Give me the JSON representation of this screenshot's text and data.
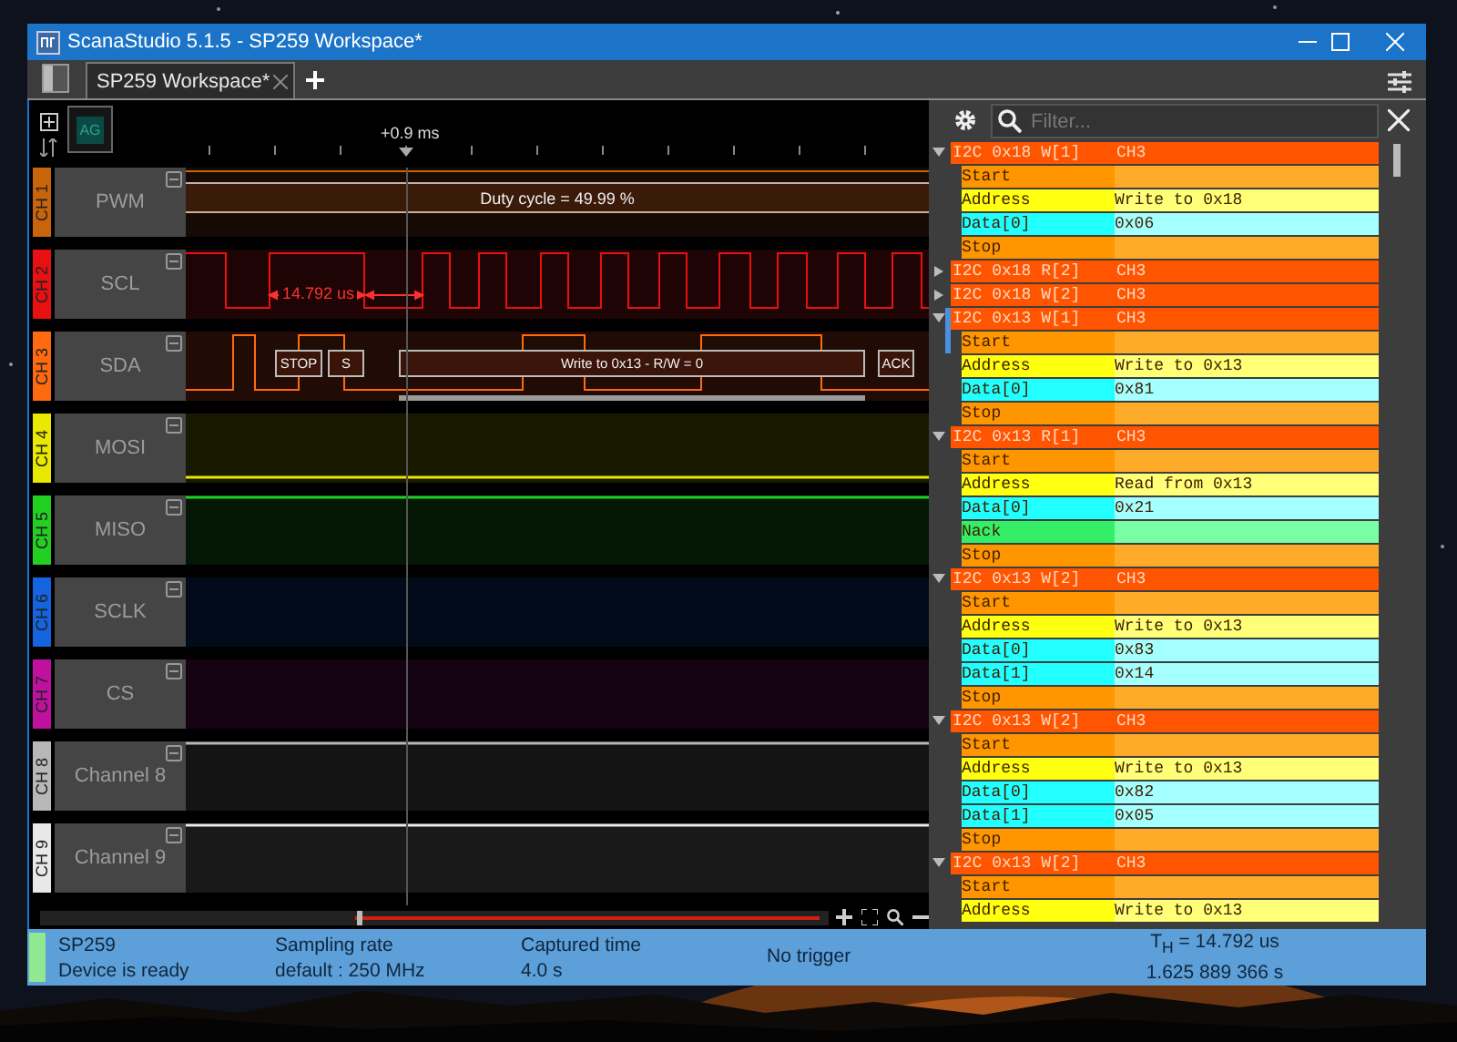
{
  "window": {
    "title": "ScanaStudio 5.1.5 - SP259 Workspace*"
  },
  "tabs": [
    {
      "label": "SP259 Workspace*",
      "selected": true
    }
  ],
  "ruler": {
    "group_button": "AG",
    "cursor_label": "+0.9 ms"
  },
  "channels": [
    {
      "tag": "CH 1",
      "name": "PWM",
      "color": "#c8650a",
      "kind": "pwm",
      "annotation": "Duty cycle = 49.99 %"
    },
    {
      "tag": "CH 2",
      "name": "SCL",
      "color": "#e81010",
      "kind": "clock",
      "measurement": "14.792 us"
    },
    {
      "tag": "CH 3",
      "name": "SDA",
      "color": "#ff6a10",
      "kind": "data",
      "frames": [
        "STOP",
        "S",
        "Write to 0x13 - R/W = 0",
        "ACK"
      ]
    },
    {
      "tag": "CH 4",
      "name": "MOSI",
      "color": "#e8e800",
      "kind": "low"
    },
    {
      "tag": "CH 5",
      "name": "MISO",
      "color": "#22d022",
      "kind": "high"
    },
    {
      "tag": "CH 6",
      "name": "SCLK",
      "color": "#1464e0",
      "kind": "idle"
    },
    {
      "tag": "CH 7",
      "name": "CS",
      "color": "#c010a0",
      "kind": "idle"
    },
    {
      "tag": "CH 8",
      "name": "Channel 8",
      "color": "#b8b8b8",
      "kind": "high"
    },
    {
      "tag": "CH 9",
      "name": "Channel 9",
      "color": "#e8e8e8",
      "kind": "high"
    }
  ],
  "decoder": {
    "filter_placeholder": "Filter...",
    "packets": [
      {
        "title": "I2C 0x18 W[1]",
        "channel": "CH3",
        "expanded": true,
        "selected": false,
        "fields": [
          {
            "kind": "start",
            "label": "Start"
          },
          {
            "kind": "address",
            "label": "Address",
            "value": "Write to 0x18"
          },
          {
            "kind": "data",
            "label": "Data[0]",
            "value": "0x06"
          },
          {
            "kind": "stop",
            "label": "Stop"
          }
        ]
      },
      {
        "title": "I2C 0x18 R[2]",
        "channel": "CH3",
        "expanded": false,
        "selected": false
      },
      {
        "title": "I2C 0x18 W[2]",
        "channel": "CH3",
        "expanded": false,
        "selected": false
      },
      {
        "title": "I2C 0x13 W[1]",
        "channel": "CH3",
        "expanded": true,
        "selected": true,
        "fields": [
          {
            "kind": "start",
            "label": "Start"
          },
          {
            "kind": "address",
            "label": "Address",
            "value": "Write to 0x13"
          },
          {
            "kind": "data",
            "label": "Data[0]",
            "value": "0x81"
          },
          {
            "kind": "stop",
            "label": "Stop"
          }
        ]
      },
      {
        "title": "I2C 0x13 R[1]",
        "channel": "CH3",
        "expanded": true,
        "selected": false,
        "fields": [
          {
            "kind": "start",
            "label": "Start"
          },
          {
            "kind": "address",
            "label": "Address",
            "value": "Read from 0x13"
          },
          {
            "kind": "data",
            "label": "Data[0]",
            "value": "0x21"
          },
          {
            "kind": "nack",
            "label": "Nack"
          },
          {
            "kind": "stop",
            "label": "Stop"
          }
        ]
      },
      {
        "title": "I2C 0x13 W[2]",
        "channel": "CH3",
        "expanded": true,
        "selected": false,
        "fields": [
          {
            "kind": "start",
            "label": "Start"
          },
          {
            "kind": "address",
            "label": "Address",
            "value": "Write to 0x13"
          },
          {
            "kind": "data",
            "label": "Data[0]",
            "value": "0x83"
          },
          {
            "kind": "data",
            "label": "Data[1]",
            "value": "0x14"
          },
          {
            "kind": "stop",
            "label": "Stop"
          }
        ]
      },
      {
        "title": "I2C 0x13 W[2]",
        "channel": "CH3",
        "expanded": true,
        "selected": false,
        "fields": [
          {
            "kind": "start",
            "label": "Start"
          },
          {
            "kind": "address",
            "label": "Address",
            "value": "Write to 0x13"
          },
          {
            "kind": "data",
            "label": "Data[0]",
            "value": "0x82"
          },
          {
            "kind": "data",
            "label": "Data[1]",
            "value": "0x05"
          },
          {
            "kind": "stop",
            "label": "Stop"
          }
        ]
      },
      {
        "title": "I2C 0x13 W[2]",
        "channel": "CH3",
        "expanded": true,
        "selected": false,
        "fields": [
          {
            "kind": "start",
            "label": "Start"
          },
          {
            "kind": "address",
            "label": "Address",
            "value": "Write to 0x13"
          }
        ]
      }
    ]
  },
  "status_bar": {
    "device": "SP259",
    "device_status": "Device is ready",
    "ready": true,
    "sampling_label": "Sampling rate",
    "sampling_value": "default : 250 MHz",
    "captured_label": "Captured time",
    "captured_value": "4.0 s",
    "trigger": "No trigger",
    "period": "T$_{H}$ = 14.792 us",
    "timestamp": "1.625 889 366 s"
  }
}
